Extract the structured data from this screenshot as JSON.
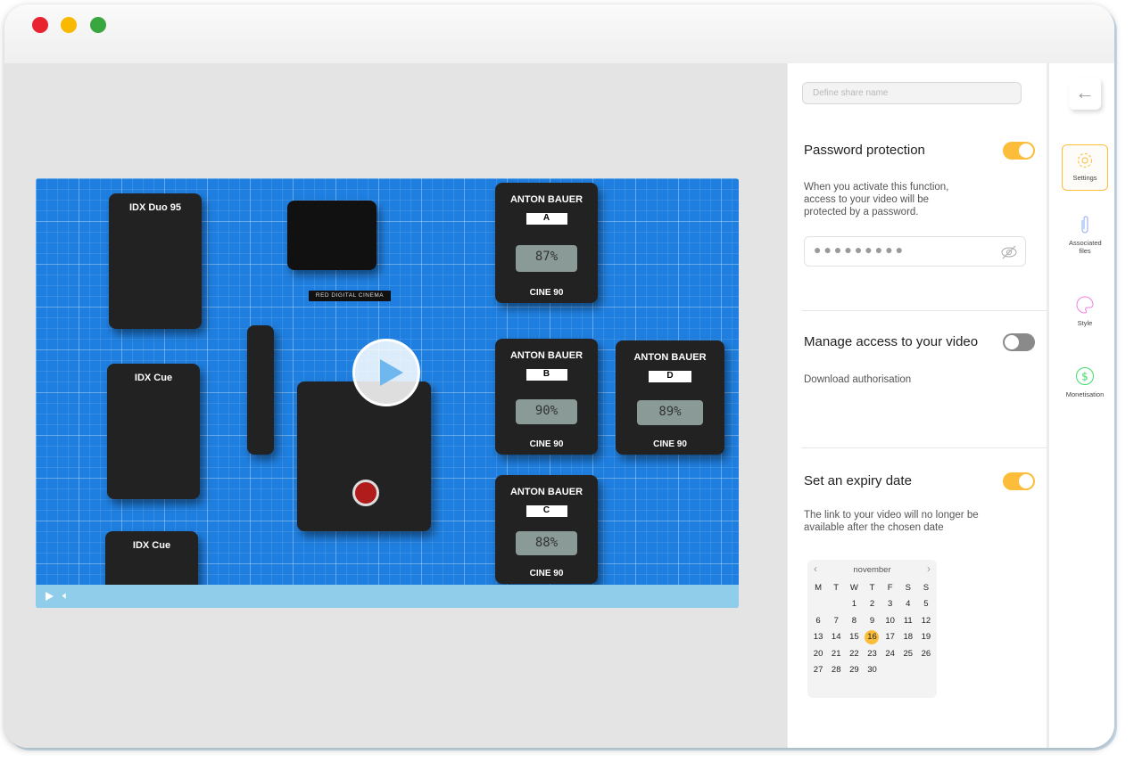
{
  "window": {
    "controls": [
      "close",
      "minimize",
      "maximize"
    ]
  },
  "video": {
    "batteries_left": [
      "IDX Duo 95",
      "IDX Cue",
      "IDX Cue"
    ],
    "batteries_right": [
      {
        "brand": "ANTON BAUER",
        "label": "A",
        "reading": "87%",
        "model": "CINE 90"
      },
      {
        "brand": "ANTON BAUER",
        "label": "B",
        "reading": "90%",
        "model": "CINE 90"
      },
      {
        "brand": "ANTON BAUER",
        "label": "D",
        "reading": "89%",
        "model": "CINE 90"
      },
      {
        "brand": "ANTON BAUER",
        "label": "C",
        "reading": "88%",
        "model": "CINE 90"
      }
    ],
    "camera_text": "RED DIGITAL CINEMA",
    "progress": 0
  },
  "panel": {
    "share_name_placeholder": "Define share name",
    "password": {
      "title": "Password protection",
      "enabled": true,
      "description": "When you activate this function, access to your video will be protected by a password.",
      "masked_value": "●●●●●●●●●"
    },
    "access": {
      "title": "Manage access to your video",
      "enabled": false,
      "description": "Download authorisation"
    },
    "expiry": {
      "title": "Set an expiry date",
      "enabled": true,
      "description": "The link to your video will no longer be available after the chosen date"
    },
    "calendar": {
      "month": "november",
      "weekdays": [
        "M",
        "T",
        "W",
        "T",
        "F",
        "S",
        "S"
      ],
      "weeks": [
        [
          "",
          "",
          "1",
          "2",
          "3",
          "4",
          "5"
        ],
        [
          "6",
          "7",
          "8",
          "9",
          "10",
          "11",
          "12"
        ],
        [
          "13",
          "14",
          "15",
          "16",
          "17",
          "18",
          "19"
        ],
        [
          "20",
          "21",
          "22",
          "23",
          "24",
          "25",
          "26"
        ],
        [
          "27",
          "28",
          "29",
          "30",
          "",
          "",
          ""
        ]
      ],
      "selected": "16"
    }
  },
  "sidebar": {
    "items": [
      {
        "label": "Settings",
        "icon": "gear-icon",
        "active": true
      },
      {
        "label": "Associated files",
        "icon": "paperclip-icon"
      },
      {
        "label": "Style",
        "icon": "palette-icon"
      },
      {
        "label": "Monetisation",
        "icon": "dollar-icon"
      }
    ]
  },
  "colors": {
    "accent": "#fbbd3a",
    "toggle_off": "#8a8a8a"
  }
}
